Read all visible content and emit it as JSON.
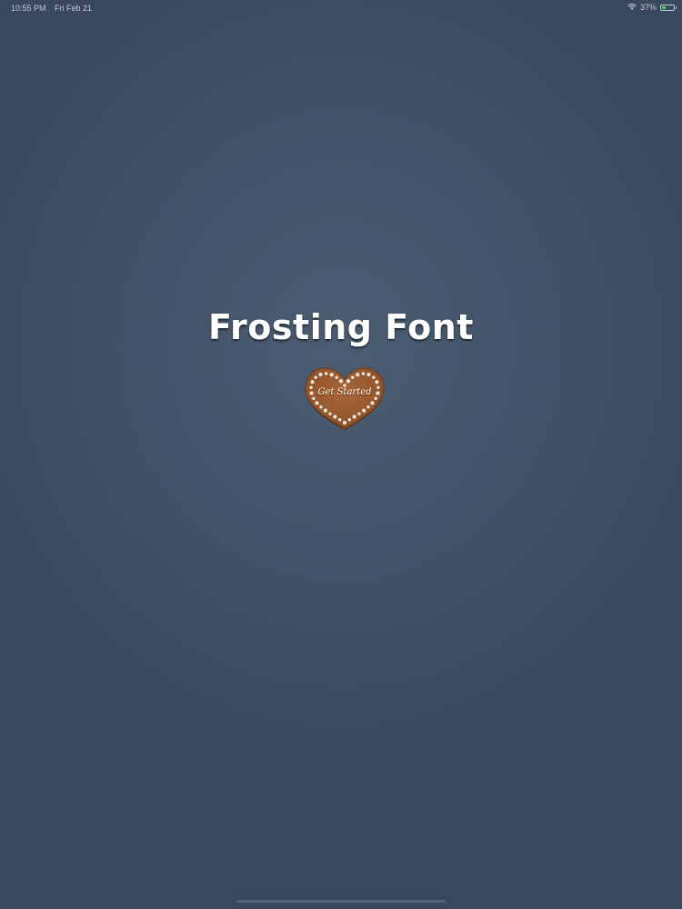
{
  "status_bar": {
    "time": "10:55 PM",
    "date": "Fri Feb 21",
    "battery_percent": "37%",
    "battery_level": 0.37,
    "wifi_icon": "wifi-icon",
    "battery_icon": "battery-icon"
  },
  "main": {
    "title": "Frosting Font",
    "get_started_label": "Get Started",
    "button_shape": "gingerbread-heart"
  },
  "colors": {
    "background": "#43546a",
    "title": "#ffffff",
    "cookie": "#9a5a2e",
    "icing_dots": "#f2e6da",
    "battery_fill": "#4cd964"
  }
}
